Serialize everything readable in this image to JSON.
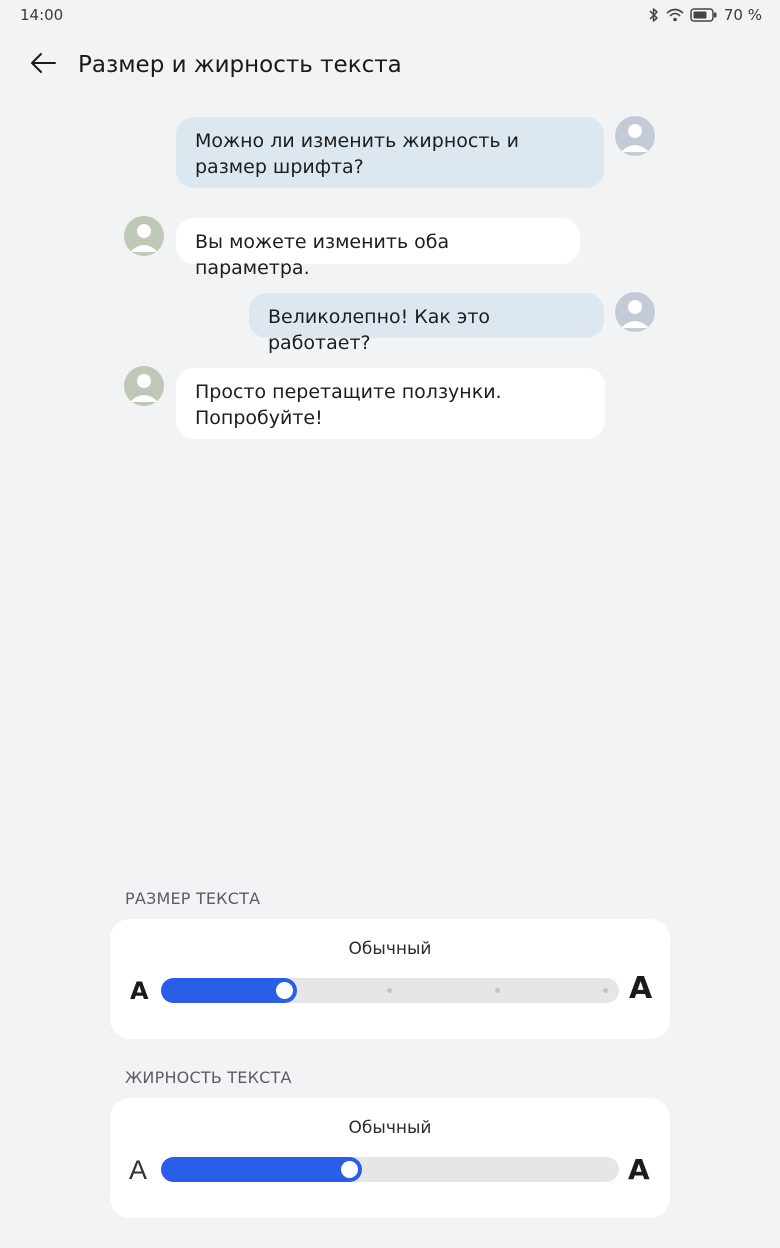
{
  "status_bar": {
    "time": "14:00",
    "battery_text": "70 %",
    "icons": [
      "bluetooth-icon",
      "wifi-icon",
      "battery-icon"
    ]
  },
  "header": {
    "title": "Размер и жирность текста",
    "back_icon": "arrow-left-icon"
  },
  "chat": {
    "messages": [
      {
        "from": "user",
        "text": "Можно ли изменить жирность и размер шрифта?"
      },
      {
        "from": "bot",
        "text": "Вы можете изменить оба параметра."
      },
      {
        "from": "user",
        "text": "Великолепно! Как это работает?"
      },
      {
        "from": "bot",
        "text": "Просто перетащите ползунки. Попробуйте!"
      }
    ]
  },
  "text_size": {
    "label": "РАЗМЕР ТЕКСТА",
    "value": "Обычный",
    "min_glyph": "A",
    "max_glyph": "A",
    "steps": 5,
    "level": 0.25
  },
  "text_weight": {
    "label": "ЖИРНОСТЬ ТЕКСТА",
    "value": "Обычный",
    "min_glyph": "A",
    "max_glyph": "A",
    "level": 0.4
  },
  "colors": {
    "accent": "#2a5ee8",
    "user_bubble": "#dce7f0",
    "bot_bubble": "#ffffff",
    "background": "#f1f3f5"
  }
}
